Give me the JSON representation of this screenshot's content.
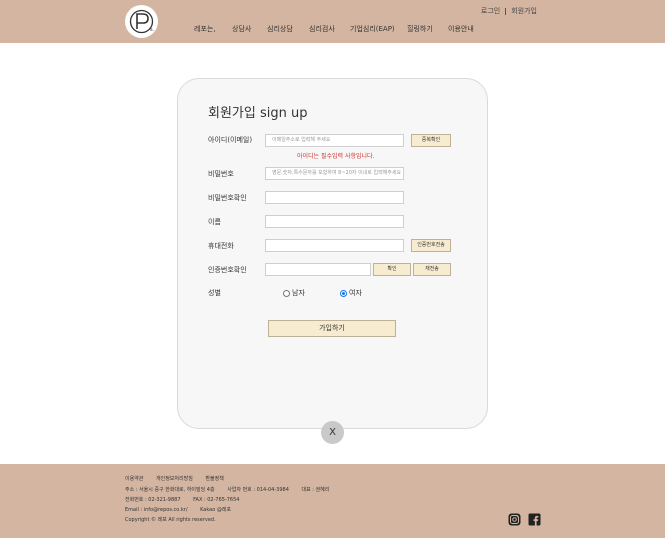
{
  "header": {
    "logo_sub": "s.",
    "top_links": [
      "로그인",
      "회원가입"
    ],
    "nav": [
      "레포는,",
      "상담사",
      "심리상담",
      "심리검사",
      "기업심리(EAP)",
      "힐링하기",
      "이용안내"
    ]
  },
  "form": {
    "title": "회원가입 sign up",
    "id_label": "아이디(이메일)",
    "id_placeholder": "이메일주소로 입력해 주세요",
    "dup_check": "중복확인",
    "id_error": "아이디는 필수입력 사항입니다.",
    "pw_label": "비밀번호",
    "pw_placeholder": "영문,숫자,특수문자를 포함하여 8~20자 이내로 입력해주세요",
    "pw_confirm_label": "비밀번호확인",
    "name_label": "이름",
    "phone_label": "휴대전화",
    "send_code": "인증번호전송",
    "code_label": "인증번호확인",
    "confirm": "확인",
    "resend": "재전송",
    "gender_label": "성별",
    "male": "남자",
    "female": "여자",
    "gender_selected": "여자",
    "submit": "가입하기",
    "close": "X"
  },
  "footer": {
    "links": [
      "이용약관",
      "개인정보처리방침",
      "환불정책"
    ],
    "address": "주소 : 서울시 중구 한화대로, 하이빌딩 4층",
    "biz_no": "사업자 번호 : 014-04-3984",
    "ceo": "대표 : 권혜리",
    "phone": "전화번호 : 02-321-9887",
    "fax": "FAX : 02-765-7654",
    "email": "Email : info@repos.co.kr/",
    "kakao": "Kakao @레포",
    "copyright": "Copyright © 레포 All rights reserved."
  },
  "colors": {
    "brand_bg": "#d3b5a1",
    "button_bg": "#f8ecd0",
    "error": "#d0312d"
  },
  "icons": [
    "instagram-icon",
    "facebook-icon"
  ]
}
